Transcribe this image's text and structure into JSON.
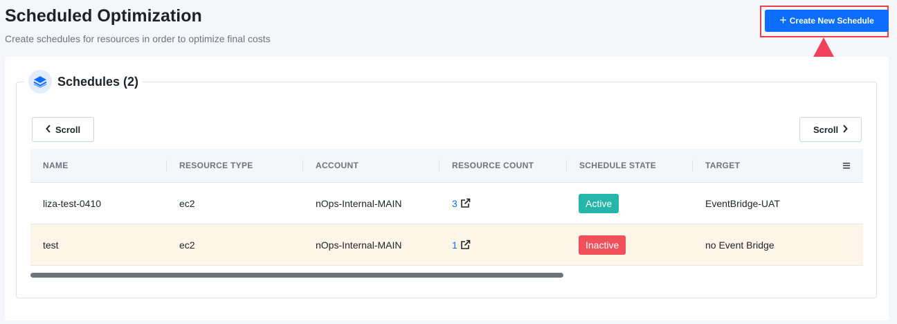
{
  "header": {
    "title": "Scheduled Optimization",
    "subtitle": "Create schedules for resources in order to optimize final costs",
    "create_button_label": "Create New Schedule"
  },
  "schedules_panel": {
    "title": "Schedules (2)",
    "scroll_left_label": "Scroll",
    "scroll_right_label": "Scroll"
  },
  "table": {
    "columns": [
      "NAME",
      "RESOURCE TYPE",
      "ACCOUNT",
      "RESOURCE COUNT",
      "SCHEDULE STATE",
      "TARGET"
    ],
    "rows": [
      {
        "name": "liza-test-0410",
        "resource_type": "ec2",
        "account": "nOps-Internal-MAIN",
        "resource_count": "3",
        "state": "Active",
        "target": "EventBridge-UAT"
      },
      {
        "name": "test",
        "resource_type": "ec2",
        "account": "nOps-Internal-MAIN",
        "resource_count": "1",
        "state": "Inactive",
        "target": "no Event Bridge"
      }
    ]
  },
  "colors": {
    "primary": "#0d6efd",
    "active": "#26b5a9",
    "inactive": "#f0505a",
    "highlight": "#e8414b"
  }
}
